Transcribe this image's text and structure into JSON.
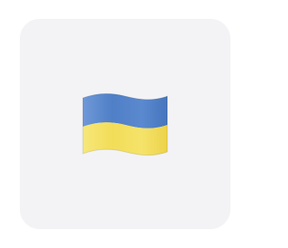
{
  "icon": {
    "name": "ukraine-flag-icon",
    "colors": {
      "tile_background": "#f3f3f5",
      "flag_top": "#4f7fc7",
      "flag_bottom": "#f2dd58",
      "flag_edge": "#c8a83a"
    }
  }
}
